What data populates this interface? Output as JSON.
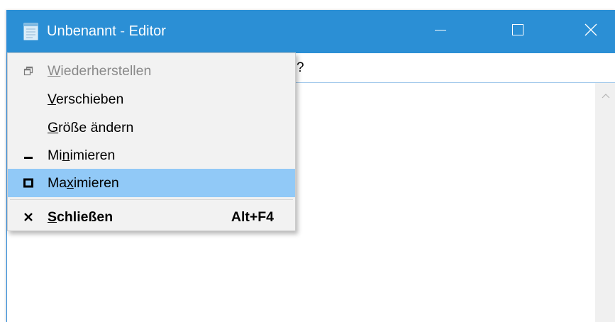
{
  "window": {
    "title": "Unbenannt",
    "title_sep": " - ",
    "app_name": "Editor",
    "accent_color": "#2b8fd5"
  },
  "caption_buttons": [
    {
      "name": "minimize",
      "icon": "minimize-icon"
    },
    {
      "name": "maximize",
      "icon": "maximize-icon"
    },
    {
      "name": "close",
      "icon": "close-icon"
    }
  ],
  "menubar": {
    "visible_text": "?"
  },
  "system_menu": {
    "highlight_color": "#91c9f7",
    "items": [
      {
        "before": "",
        "accel": "W",
        "after": "iederherstellen",
        "icon": "restore-icon",
        "enabled": false
      },
      {
        "before": "",
        "accel": "V",
        "after": "erschieben",
        "icon": "",
        "enabled": true
      },
      {
        "before": "",
        "accel": "G",
        "after": "röße ändern",
        "icon": "",
        "enabled": true
      },
      {
        "before": "Mi",
        "accel": "n",
        "after": "imieren",
        "icon": "minimize-icon",
        "enabled": true
      },
      {
        "before": "Ma",
        "accel": "x",
        "after": "imieren",
        "icon": "maximize-icon",
        "enabled": true,
        "highlighted": true
      },
      {
        "before": "",
        "accel": "S",
        "after": "chließen",
        "icon": "close-icon",
        "enabled": true,
        "default": true,
        "shortcut": "Alt+F4"
      }
    ]
  },
  "scrollbar": {
    "up_icon": "chevron-up-icon"
  }
}
